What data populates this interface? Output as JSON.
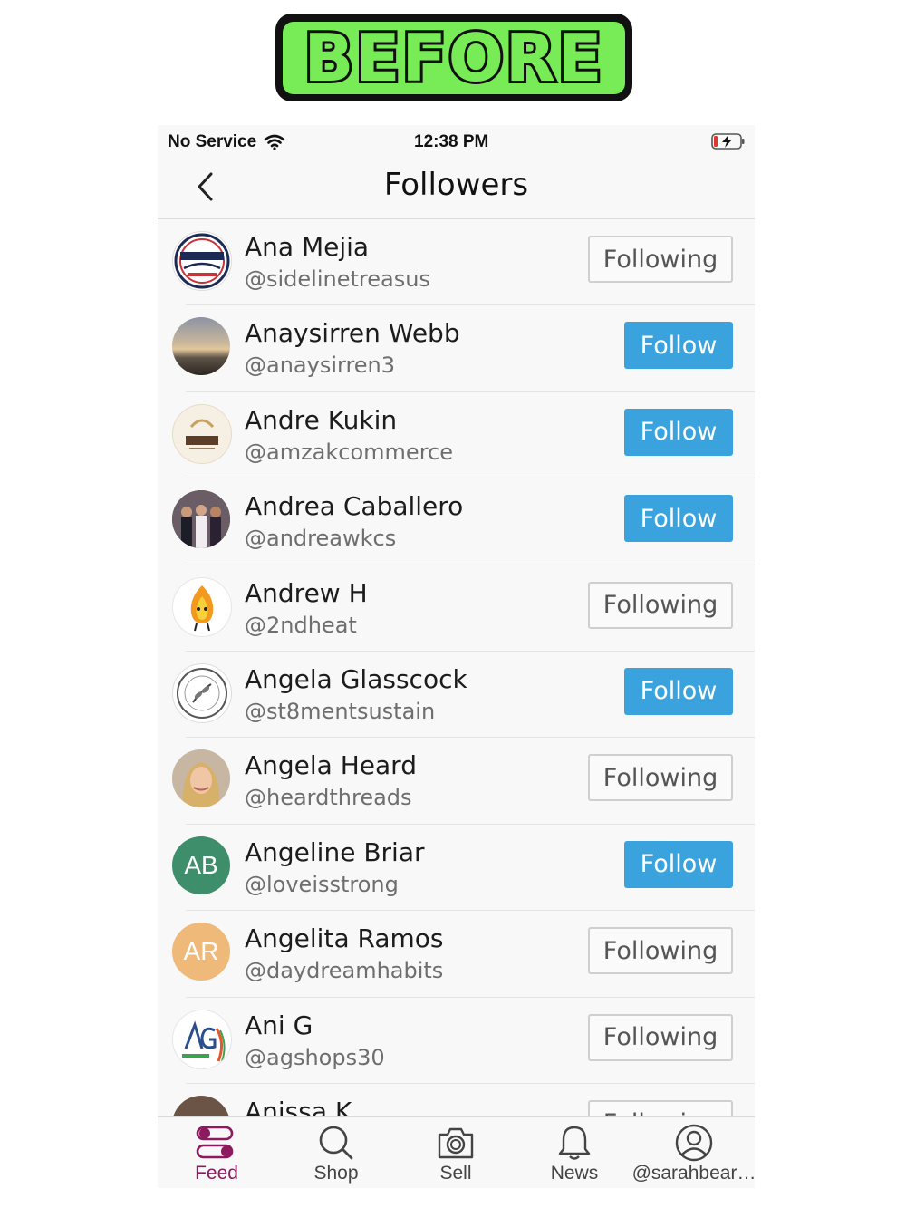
{
  "banner": {
    "text": "BEFORE"
  },
  "status_bar": {
    "carrier": "No Service",
    "time": "12:38 PM"
  },
  "header": {
    "title": "Followers"
  },
  "colors": {
    "follow_blue": "#3aa3dd",
    "accent": "#8b1b5e",
    "ab_green": "#3e8e6b",
    "ar_orange": "#efb97a"
  },
  "followers": [
    {
      "name": "Ana Mejia",
      "handle": "@sidelinetreasus",
      "button": "Following",
      "avatar_icon": "sideline-logo-avatar"
    },
    {
      "name": "Anaysirren Webb",
      "handle": "@anaysirren3",
      "button": "Follow",
      "avatar_icon": "sunset-photo-avatar"
    },
    {
      "name": "Andre Kukin",
      "handle": "@amzakcommerce",
      "button": "Follow",
      "avatar_icon": "amzak-logo-avatar"
    },
    {
      "name": "Andrea Caballero",
      "handle": "@andreawkcs",
      "button": "Follow",
      "avatar_icon": "family-photo-avatar"
    },
    {
      "name": "Andrew H",
      "handle": "@2ndheat",
      "button": "Following",
      "avatar_icon": "flame-mascot-avatar"
    },
    {
      "name": "Angela Glasscock",
      "handle": "@st8mentsustain",
      "button": "Follow",
      "avatar_icon": "sustainable-logo-avatar"
    },
    {
      "name": "Angela Heard",
      "handle": "@heardthreads",
      "button": "Following",
      "avatar_icon": "portrait-photo-avatar"
    },
    {
      "name": "Angeline Briar",
      "handle": "@loveisstrong",
      "button": "Follow",
      "avatar_initials": "AB"
    },
    {
      "name": "Angelita Ramos",
      "handle": "@daydreamhabits",
      "button": "Following",
      "avatar_initials": "AR"
    },
    {
      "name": "Ani G",
      "handle": "@agshops30",
      "button": "Following",
      "avatar_icon": "ag-shops-logo-avatar"
    },
    {
      "name": "Anissa K",
      "handle": "",
      "button": "Following",
      "avatar_icon": "photo-avatar"
    }
  ],
  "tabs": [
    {
      "label": "Feed",
      "icon": "feed-icon",
      "active": true
    },
    {
      "label": "Shop",
      "icon": "search-icon"
    },
    {
      "label": "Sell",
      "icon": "camera-icon"
    },
    {
      "label": "News",
      "icon": "bell-icon"
    },
    {
      "label": "@sarahbear…",
      "icon": "profile-icon"
    }
  ]
}
